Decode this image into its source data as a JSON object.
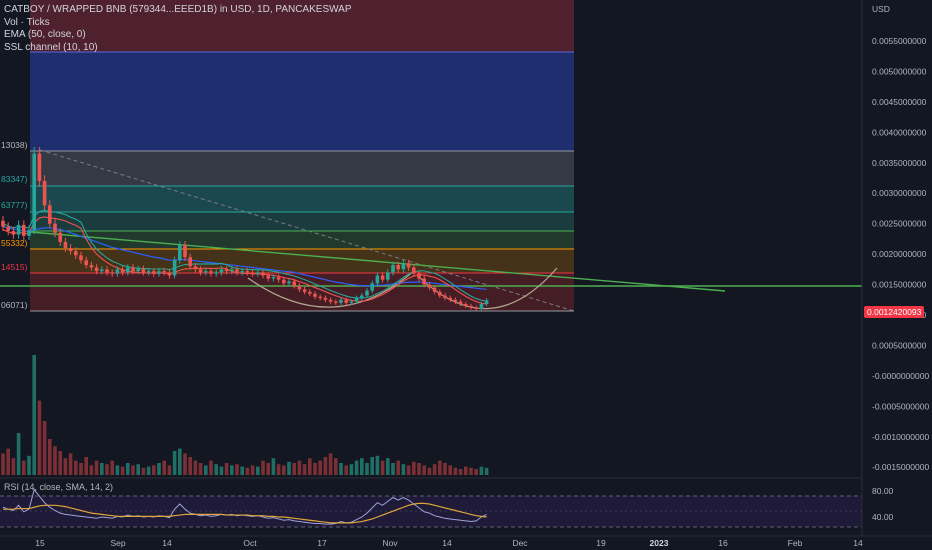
{
  "legend": {
    "title": "CATBOY / WRAPPED BNB (579344...EEED1B) in USD, 1D, PANCAKESWAP",
    "vol": "Vol · Ticks",
    "ema": "EMA (50, close, 0)",
    "ssl": "SSL channel (10, 10)"
  },
  "price_axis": {
    "currency": "USD",
    "ticks": [
      "0.0055000000",
      "0.0050000000",
      "0.0045000000",
      "0.0040000000",
      "0.0035000000",
      "0.0030000000",
      "0.0025000000",
      "0.0020000000",
      "0.0015000000",
      "0.0010000000",
      "0.0005000000",
      "-0.0000000000",
      "-0.0005000000",
      "-0.0010000000",
      "-0.0015000000"
    ],
    "last_price": "0.0012420093",
    "last_price_color": "#f23645"
  },
  "rsi": {
    "label": "RSI (14, close, SMA, 14, 2)",
    "ticks": [
      "80.00",
      "40.00"
    ]
  },
  "time_axis": {
    "labels": [
      "15",
      "Sep",
      "14",
      "Oct",
      "17",
      "Nov",
      "14",
      "Dec",
      "19",
      "2023",
      "16",
      "Feb",
      "14"
    ]
  },
  "fib_labels": [
    "13038)",
    "83347)",
    "63777)",
    "55332)",
    "14515)",
    "06071)"
  ],
  "colors": {
    "up": "#26a69a",
    "down": "#ef5350",
    "ema": "#2962ff",
    "trendline": "#4caf50",
    "background": "#131722"
  },
  "chart_data": {
    "type": "candlestick",
    "price_ylim": [
      -0.0018,
      0.0058
    ],
    "rsi_ylim": [
      25,
      90
    ],
    "candles": [
      {
        "o": 0.00255,
        "c": 0.00245
      },
      {
        "o": 0.00245,
        "c": 0.00238
      },
      {
        "o": 0.00238,
        "c": 0.00232
      },
      {
        "o": 0.00232,
        "c": 0.00248
      },
      {
        "o": 0.00248,
        "c": 0.0023
      },
      {
        "o": 0.0023,
        "c": 0.0024
      },
      {
        "o": 0.0024,
        "c": 0.00365
      },
      {
        "o": 0.00365,
        "c": 0.0032
      },
      {
        "o": 0.0032,
        "c": 0.0028
      },
      {
        "o": 0.0028,
        "c": 0.0025
      },
      {
        "o": 0.0025,
        "c": 0.00235
      },
      {
        "o": 0.00235,
        "c": 0.0022
      },
      {
        "o": 0.0022,
        "c": 0.0021
      },
      {
        "o": 0.0021,
        "c": 0.00205
      },
      {
        "o": 0.00205,
        "c": 0.00198
      },
      {
        "o": 0.00198,
        "c": 0.0019
      },
      {
        "o": 0.0019,
        "c": 0.00182
      },
      {
        "o": 0.00182,
        "c": 0.00178
      },
      {
        "o": 0.00178,
        "c": 0.00172
      },
      {
        "o": 0.00172,
        "c": 0.00175
      },
      {
        "o": 0.00175,
        "c": 0.0017
      },
      {
        "o": 0.0017,
        "c": 0.00168
      },
      {
        "o": 0.00168,
        "c": 0.00175
      },
      {
        "o": 0.00175,
        "c": 0.0017
      },
      {
        "o": 0.0017,
        "c": 0.00178
      },
      {
        "o": 0.00178,
        "c": 0.00172
      },
      {
        "o": 0.00172,
        "c": 0.00176
      },
      {
        "o": 0.00176,
        "c": 0.0017
      },
      {
        "o": 0.0017,
        "c": 0.00172
      },
      {
        "o": 0.00172,
        "c": 0.00168
      },
      {
        "o": 0.00168,
        "c": 0.00172
      },
      {
        "o": 0.00172,
        "c": 0.0017
      },
      {
        "o": 0.0017,
        "c": 0.00165
      },
      {
        "o": 0.00165,
        "c": 0.0019
      },
      {
        "o": 0.0019,
        "c": 0.00215
      },
      {
        "o": 0.00215,
        "c": 0.00195
      },
      {
        "o": 0.00195,
        "c": 0.0018
      },
      {
        "o": 0.0018,
        "c": 0.00175
      },
      {
        "o": 0.00175,
        "c": 0.0017
      },
      {
        "o": 0.0017,
        "c": 0.00172
      },
      {
        "o": 0.00172,
        "c": 0.00168
      },
      {
        "o": 0.00168,
        "c": 0.0017
      },
      {
        "o": 0.0017,
        "c": 0.00175
      },
      {
        "o": 0.00175,
        "c": 0.00172
      },
      {
        "o": 0.00172,
        "c": 0.00175
      },
      {
        "o": 0.00175,
        "c": 0.0017
      },
      {
        "o": 0.0017,
        "c": 0.00172
      },
      {
        "o": 0.00172,
        "c": 0.0017
      },
      {
        "o": 0.0017,
        "c": 0.00168
      },
      {
        "o": 0.00168,
        "c": 0.0017
      },
      {
        "o": 0.0017,
        "c": 0.00165
      },
      {
        "o": 0.00165,
        "c": 0.0016
      },
      {
        "o": 0.0016,
        "c": 0.00162
      },
      {
        "o": 0.00162,
        "c": 0.00158
      },
      {
        "o": 0.00158,
        "c": 0.00152
      },
      {
        "o": 0.00152,
        "c": 0.00155
      },
      {
        "o": 0.00155,
        "c": 0.00148
      },
      {
        "o": 0.00148,
        "c": 0.00142
      },
      {
        "o": 0.00142,
        "c": 0.00138
      },
      {
        "o": 0.00138,
        "c": 0.00135
      },
      {
        "o": 0.00135,
        "c": 0.0013
      },
      {
        "o": 0.0013,
        "c": 0.00128
      },
      {
        "o": 0.00128,
        "c": 0.00125
      },
      {
        "o": 0.00125,
        "c": 0.00122
      },
      {
        "o": 0.00122,
        "c": 0.0012
      },
      {
        "o": 0.0012,
        "c": 0.00125
      },
      {
        "o": 0.00125,
        "c": 0.0012
      },
      {
        "o": 0.0012,
        "c": 0.00122
      },
      {
        "o": 0.00122,
        "c": 0.00128
      },
      {
        "o": 0.00128,
        "c": 0.00132
      },
      {
        "o": 0.00132,
        "c": 0.0014
      },
      {
        "o": 0.0014,
        "c": 0.00152
      },
      {
        "o": 0.00152,
        "c": 0.00165
      },
      {
        "o": 0.00165,
        "c": 0.00158
      },
      {
        "o": 0.00158,
        "c": 0.0017
      },
      {
        "o": 0.0017,
        "c": 0.00182
      },
      {
        "o": 0.00182,
        "c": 0.00175
      },
      {
        "o": 0.00175,
        "c": 0.00185
      },
      {
        "o": 0.00185,
        "c": 0.00178
      },
      {
        "o": 0.00178,
        "c": 0.00168
      },
      {
        "o": 0.00168,
        "c": 0.0016
      },
      {
        "o": 0.0016,
        "c": 0.0015
      },
      {
        "o": 0.0015,
        "c": 0.00145
      },
      {
        "o": 0.00145,
        "c": 0.00138
      },
      {
        "o": 0.00138,
        "c": 0.00132
      },
      {
        "o": 0.00132,
        "c": 0.00128
      },
      {
        "o": 0.00128,
        "c": 0.00125
      },
      {
        "o": 0.00125,
        "c": 0.00122
      },
      {
        "o": 0.00122,
        "c": 0.00118
      },
      {
        "o": 0.00118,
        "c": 0.00115
      },
      {
        "o": 0.00115,
        "c": 0.00112
      },
      {
        "o": 0.00112,
        "c": 0.0011
      },
      {
        "o": 0.0011,
        "c": 0.00118
      },
      {
        "o": 0.00118,
        "c": 0.00124
      }
    ],
    "volumes": [
      18,
      22,
      14,
      35,
      12,
      16,
      100,
      62,
      45,
      30,
      24,
      20,
      14,
      18,
      12,
      10,
      15,
      8,
      12,
      10,
      9,
      12,
      8,
      7,
      10,
      8,
      9,
      6,
      7,
      8,
      10,
      12,
      8,
      20,
      22,
      18,
      15,
      12,
      10,
      8,
      12,
      9,
      7,
      10,
      8,
      9,
      7,
      6,
      8,
      7,
      12,
      10,
      14,
      9,
      8,
      11,
      10,
      12,
      9,
      14,
      10,
      12,
      15,
      18,
      14,
      10,
      8,
      9,
      12,
      14,
      10,
      15,
      16,
      12,
      14,
      10,
      12,
      9,
      8,
      11,
      10,
      8,
      6,
      9,
      12,
      10,
      8,
      6,
      5,
      7,
      6,
      5,
      7,
      6
    ],
    "ema": [
      0.00245,
      0.00243,
      0.00241,
      0.0024,
      0.00238,
      0.00237,
      0.0024,
      0.00242,
      0.00243,
      0.00243,
      0.00242,
      0.0024,
      0.00238,
      0.00235,
      0.00232,
      0.00229,
      0.00226,
      0.00223,
      0.0022,
      0.00217,
      0.00214,
      0.00211,
      0.00209,
      0.00207,
      0.00205,
      0.00203,
      0.00201,
      0.00199,
      0.00197,
      0.00195,
      0.00194,
      0.00192,
      0.0019,
      0.0019,
      0.00191,
      0.00191,
      0.0019,
      0.00189,
      0.00188,
      0.00187,
      0.00186,
      0.00185,
      0.00184,
      0.00183,
      0.00182,
      0.00181,
      0.0018,
      0.00179,
      0.00178,
      0.00177,
      0.00176,
      0.00175,
      0.00174,
      0.00173,
      0.00172,
      0.00171,
      0.0017,
      0.00168,
      0.00166,
      0.00164,
      0.00162,
      0.0016,
      0.00158,
      0.00156,
      0.00154,
      0.00153,
      0.00151,
      0.0015,
      0.00149,
      0.00148,
      0.00148,
      0.00148,
      0.00149,
      0.00149,
      0.0015,
      0.00151,
      0.00152,
      0.00153,
      0.00154,
      0.00154,
      0.00154,
      0.00154,
      0.00153,
      0.00152,
      0.00151,
      0.0015,
      0.00149,
      0.00148,
      0.00147,
      0.00146,
      0.00145,
      0.00144,
      0.00143,
      0.00142
    ],
    "rsi": [
      55,
      52,
      50,
      58,
      48,
      52,
      82,
      72,
      62,
      55,
      50,
      46,
      44,
      43,
      42,
      41,
      40,
      39,
      38,
      40,
      39,
      38,
      41,
      40,
      43,
      41,
      42,
      40,
      41,
      40,
      42,
      41,
      39,
      52,
      60,
      52,
      46,
      44,
      42,
      43,
      41,
      42,
      44,
      43,
      44,
      42,
      43,
      42,
      41,
      42,
      40,
      38,
      39,
      37,
      35,
      36,
      34,
      33,
      32,
      31,
      30,
      30,
      29,
      29,
      30,
      33,
      31,
      32,
      36,
      40,
      46,
      54,
      62,
      58,
      64,
      70,
      66,
      70,
      66,
      60,
      54,
      48,
      46,
      42,
      40,
      38,
      37,
      36,
      35,
      34,
      33,
      34,
      40,
      44
    ],
    "rsi_ma": [
      52,
      52,
      52,
      53,
      53,
      53,
      55,
      57,
      58,
      58,
      58,
      57,
      56,
      54,
      52,
      50,
      48,
      46,
      45,
      44,
      43,
      42,
      41,
      41,
      41,
      41,
      41,
      41,
      41,
      41,
      41,
      41,
      41,
      42,
      43,
      44,
      44,
      44,
      44,
      44,
      44,
      44,
      44,
      43,
      43,
      43,
      43,
      43,
      42,
      42,
      42,
      41,
      41,
      40,
      40,
      39,
      38,
      37,
      36,
      35,
      34,
      33,
      32,
      31,
      31,
      31,
      31,
      31,
      32,
      33,
      35,
      37,
      40,
      43,
      46,
      49,
      52,
      55,
      58,
      60,
      61,
      61,
      60,
      58,
      56,
      54,
      52,
      50,
      48,
      46,
      44,
      42,
      41,
      40
    ]
  }
}
